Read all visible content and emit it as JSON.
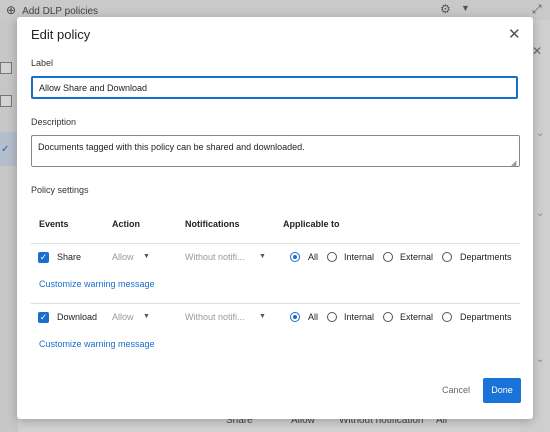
{
  "background": {
    "add_label": "Add DLP policies",
    "bottom_row": {
      "event": "Share",
      "action": "Allow",
      "notification": "Without notification",
      "applicable": "All"
    }
  },
  "modal": {
    "title": "Edit policy",
    "label_caption": "Label",
    "label_value": "Allow Share and Download",
    "description_caption": "Description",
    "description_value": "Documents tagged with this policy can be shared and downloaded.",
    "section_title": "Policy settings",
    "columns": [
      "Events",
      "Action",
      "Notifications",
      "Applicable to"
    ],
    "rows": [
      {
        "event": "Share",
        "checked": true,
        "action": "Allow",
        "notification": "Without notifi...",
        "applicable_options": [
          "All",
          "Internal",
          "External",
          "Departments"
        ],
        "selected": "All",
        "link": "Customize warning message"
      },
      {
        "event": "Download",
        "checked": true,
        "action": "Allow",
        "notification": "Without notifi...",
        "applicable_options": [
          "All",
          "Internal",
          "External",
          "Departments"
        ],
        "selected": "All",
        "link": "Customize warning message"
      }
    ],
    "cancel_label": "Cancel",
    "done_label": "Done"
  },
  "colors": {
    "accent": "#1a6dd1",
    "done_button": "#1a73d9"
  },
  "icons": {
    "close": "close-icon",
    "gear": "gear-icon",
    "expand": "expand-icon",
    "check": "check-icon",
    "caret": "caret-down-icon"
  }
}
